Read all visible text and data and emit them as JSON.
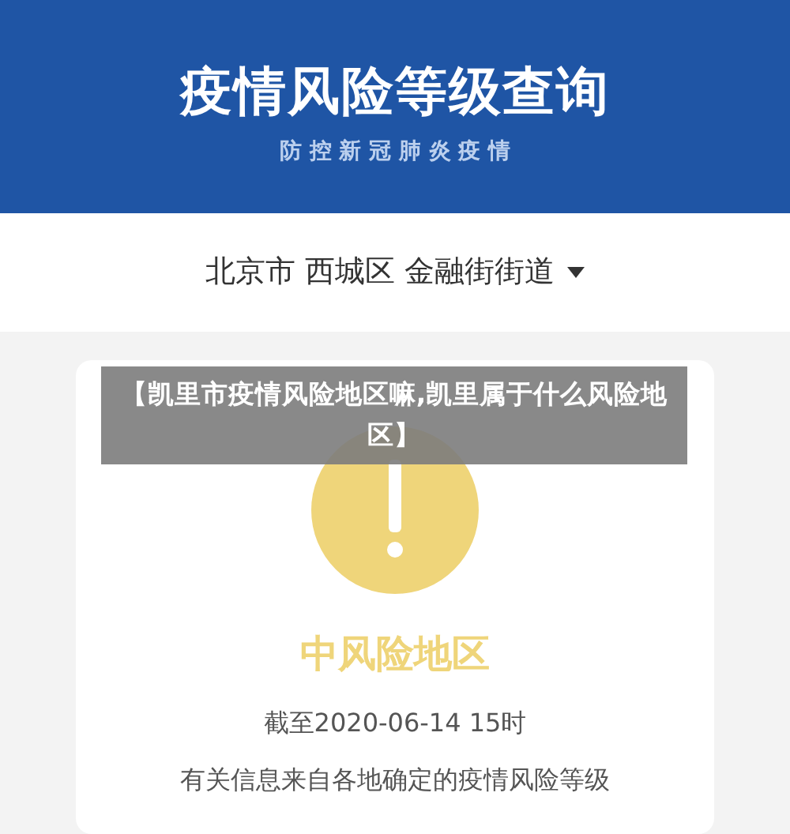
{
  "header": {
    "title": "疫情风险等级查询",
    "subtitle": "防 控 新 冠 肺 炎 疫 情"
  },
  "location": {
    "text": "北京市 西城区 金融街街道",
    "expanded": false
  },
  "result": {
    "level": "中风险地区",
    "color": "#efd57a",
    "date": "截至2020-06-14 15时",
    "note": "有关信息来自各地确定的疫情风险等级"
  },
  "caption": "【凯里市疫情风险地区嘛,凯里属于什么风险地区】"
}
